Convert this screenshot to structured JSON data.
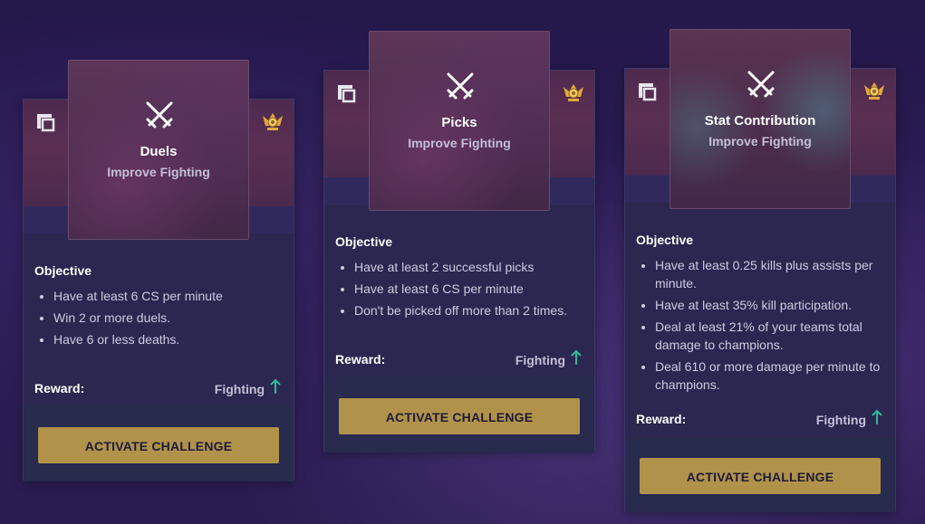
{
  "cards": [
    {
      "title": "Duels",
      "subtitle": "Improve Fighting",
      "objective_label": "Objective",
      "objectives": [
        "Have at least 6 CS per minute",
        "Win 2 or more duels.",
        "Have 6 or less deaths."
      ],
      "reward_label": "Reward:",
      "reward_value": "Fighting",
      "button_label": "ACTIVATE CHALLENGE",
      "icons": {
        "left": "square-frame-icon",
        "right": "rank-emblem-icon",
        "art": "crossed-swords-icon",
        "reward": "arrow-up-icon"
      }
    },
    {
      "title": "Picks",
      "subtitle": "Improve Fighting",
      "objective_label": "Objective",
      "objectives": [
        "Have at least 2 successful picks",
        "Have at least 6 CS per minute",
        "Don't be picked off more than 2 times."
      ],
      "reward_label": "Reward:",
      "reward_value": "Fighting",
      "button_label": "ACTIVATE CHALLENGE",
      "icons": {
        "left": "square-frame-icon",
        "right": "rank-emblem-icon",
        "art": "crossed-swords-icon",
        "reward": "arrow-up-icon"
      }
    },
    {
      "title": "Stat Contribution",
      "subtitle": "Improve Fighting",
      "objective_label": "Objective",
      "objectives": [
        "Have at least 0.25 kills plus assists per minute.",
        "Have at least 35% kill participation.",
        "Deal at least 21% of your teams total damage to champions.",
        "Deal 610 or more damage per minute to champions."
      ],
      "reward_label": "Reward:",
      "reward_value": "Fighting",
      "button_label": "ACTIVATE CHALLENGE",
      "icons": {
        "left": "square-frame-icon",
        "right": "rank-emblem-icon",
        "art": "crossed-swords-icon",
        "reward": "arrow-up-icon"
      }
    }
  ],
  "colors": {
    "accent_gold": "#b0924b",
    "reward_arrow": "#2fb89b",
    "emblem_gold": "#e2a93c",
    "card_bg": "#2b2750"
  }
}
